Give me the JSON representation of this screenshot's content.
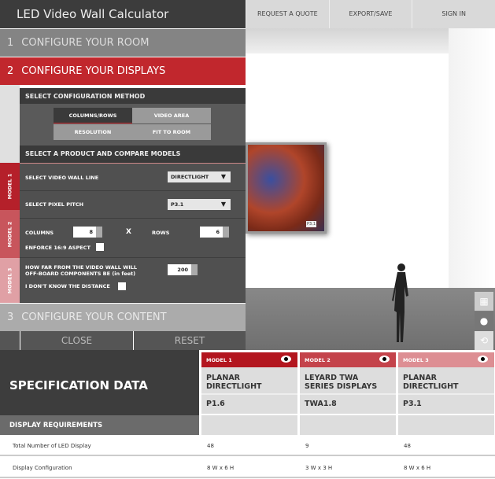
{
  "header": {
    "title": "LED Video Wall Calculator",
    "nav": [
      "REQUEST A QUOTE",
      "EXPORT/SAVE",
      "SIGN IN"
    ]
  },
  "steps": [
    {
      "num": "1",
      "label": "CONFIGURE YOUR ROOM"
    },
    {
      "num": "2",
      "label": "CONFIGURE YOUR DISPLAYS"
    },
    {
      "num": "3",
      "label": "CONFIGURE YOUR CONTENT"
    }
  ],
  "config": {
    "heading": "SELECT CONFIGURATION METHOD",
    "methods": [
      "COLUMNS/ROWS",
      "VIDEO AREA",
      "RESOLUTION",
      "FIT TO ROOM"
    ],
    "selected": "COLUMNS/ROWS"
  },
  "product": {
    "heading": "SELECT A PRODUCT AND COMPARE MODELS",
    "model_tabs": [
      "MODEL 1",
      "MODEL 2",
      "MODEL 3"
    ],
    "wall_line_label": "SELECT VIDEO WALL LINE",
    "wall_line_value": "DIRECTLIGHT",
    "pitch_label": "SELECT PIXEL PITCH",
    "pitch_value": "P3.1",
    "columns_label": "COLUMNS",
    "columns_value": "8",
    "x_label": "X",
    "rows_label": "ROWS",
    "rows_value": "6",
    "aspect_label": "ENFORCE 16:9 ASPECT",
    "distance_label_1": "HOW FAR FROM THE VIDEO WALL WILL",
    "distance_label_2": "OFF-BOARD COMPONENTS BE (in feet)",
    "distance_value": "200",
    "unknown_distance_label": "I DON'T KNOW THE DISTANCE"
  },
  "buttons": {
    "close": "CLOSE",
    "reset": "RESET"
  },
  "preview": {
    "screen_label": "P3.1"
  },
  "spec": {
    "title": "SPECIFICATION DATA",
    "section": "DISPLAY REQUIREMENTS",
    "models": [
      {
        "tab": "MODEL 1",
        "name1": "PLANAR",
        "name2": "DIRECTLIGHT",
        "code": "P1.6",
        "color": "#b3161f",
        "total": "48",
        "config": "8 W x 6 H"
      },
      {
        "tab": "MODEL 2",
        "name1": "LEYARD TWA",
        "name2": "SERIES DISPLAYS",
        "code": "TWA1.8",
        "color": "#c4434b",
        "total": "9",
        "config": "3 W x 3 H"
      },
      {
        "tab": "MODEL 3",
        "name1": "PLANAR",
        "name2": "DIRECTLIGHT",
        "code": "P3.1",
        "color": "#dd8e93",
        "total": "48",
        "config": "8 W x 6 H"
      }
    ],
    "rows": [
      "Total Number of LED Display",
      "Display Configuration"
    ]
  }
}
